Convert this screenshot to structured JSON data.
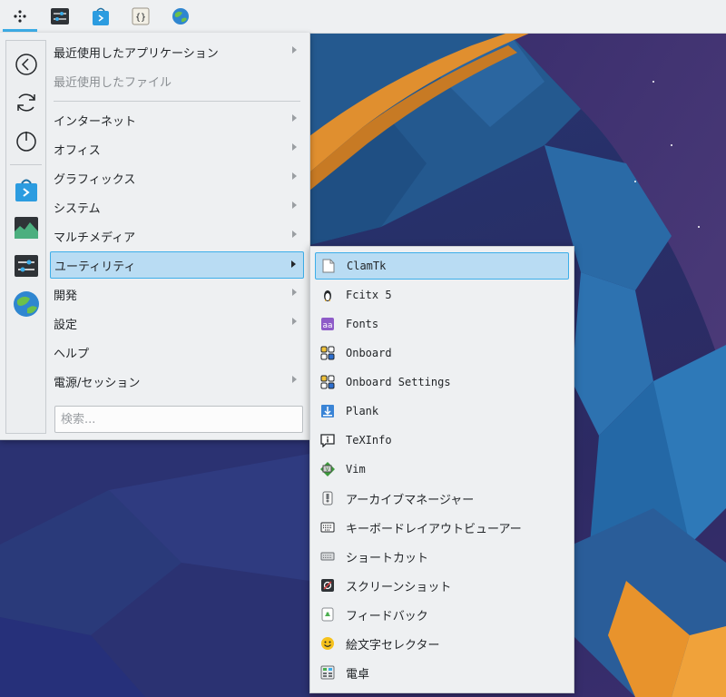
{
  "panel": {
    "launchers": [
      {
        "icon": "application-launcher-icon",
        "active": true
      },
      {
        "icon": "system-settings-icon"
      },
      {
        "icon": "discover-store-icon"
      },
      {
        "icon": "code-editor-icon"
      },
      {
        "icon": "web-browser-icon"
      }
    ]
  },
  "menu": {
    "favorites": [
      {
        "icon": "back-icon"
      },
      {
        "icon": "refresh-icon"
      },
      {
        "icon": "power-icon"
      },
      {
        "icon": "discover-store-icon"
      },
      {
        "icon": "system-monitor-icon"
      },
      {
        "icon": "system-settings-icon"
      },
      {
        "icon": "web-browser-icon"
      }
    ],
    "items": [
      {
        "label": "最近使用したアプリケーション",
        "arrow": true
      },
      {
        "label": "最近使用したファイル",
        "disabled": true
      },
      {
        "label": "インターネット",
        "arrow": true
      },
      {
        "label": "オフィス",
        "arrow": true
      },
      {
        "label": "グラフィックス",
        "arrow": true
      },
      {
        "label": "システム",
        "arrow": true
      },
      {
        "label": "マルチメディア",
        "arrow": true
      },
      {
        "label": "ユーティリティ",
        "arrow": true,
        "selected": true
      },
      {
        "label": "開発",
        "arrow": true
      },
      {
        "label": "設定",
        "arrow": true
      },
      {
        "label": "ヘルプ"
      },
      {
        "label": "電源/セッション",
        "arrow": true
      }
    ],
    "search_placeholder": "検索..."
  },
  "submenu": {
    "items": [
      {
        "label": "ClamTk",
        "icon": "file-icon",
        "selected": true
      },
      {
        "label": "Fcitx 5",
        "icon": "penguin-icon"
      },
      {
        "label": "Fonts",
        "icon": "fonts-icon"
      },
      {
        "label": "Onboard",
        "icon": "onboard-icon"
      },
      {
        "label": "Onboard Settings",
        "icon": "onboard-settings-icon"
      },
      {
        "label": "Plank",
        "icon": "plank-icon"
      },
      {
        "label": "TeXInfo",
        "icon": "info-icon"
      },
      {
        "label": "Vim",
        "icon": "vim-icon"
      },
      {
        "label": "アーカイブマネージャー",
        "icon": "archive-icon"
      },
      {
        "label": "キーボードレイアウトビューアー",
        "icon": "keyboard-icon"
      },
      {
        "label": "ショートカット",
        "icon": "shortcut-icon"
      },
      {
        "label": "スクリーンショット",
        "icon": "screenshot-icon"
      },
      {
        "label": "フィードバック",
        "icon": "feedback-icon"
      },
      {
        "label": "絵文字セレクター",
        "icon": "emoji-icon"
      },
      {
        "label": "電卓",
        "icon": "calculator-icon"
      }
    ]
  },
  "colors": {
    "accent": "#3daee9",
    "selection": "#b9dcf3",
    "menu_bg": "#eef0f2"
  }
}
